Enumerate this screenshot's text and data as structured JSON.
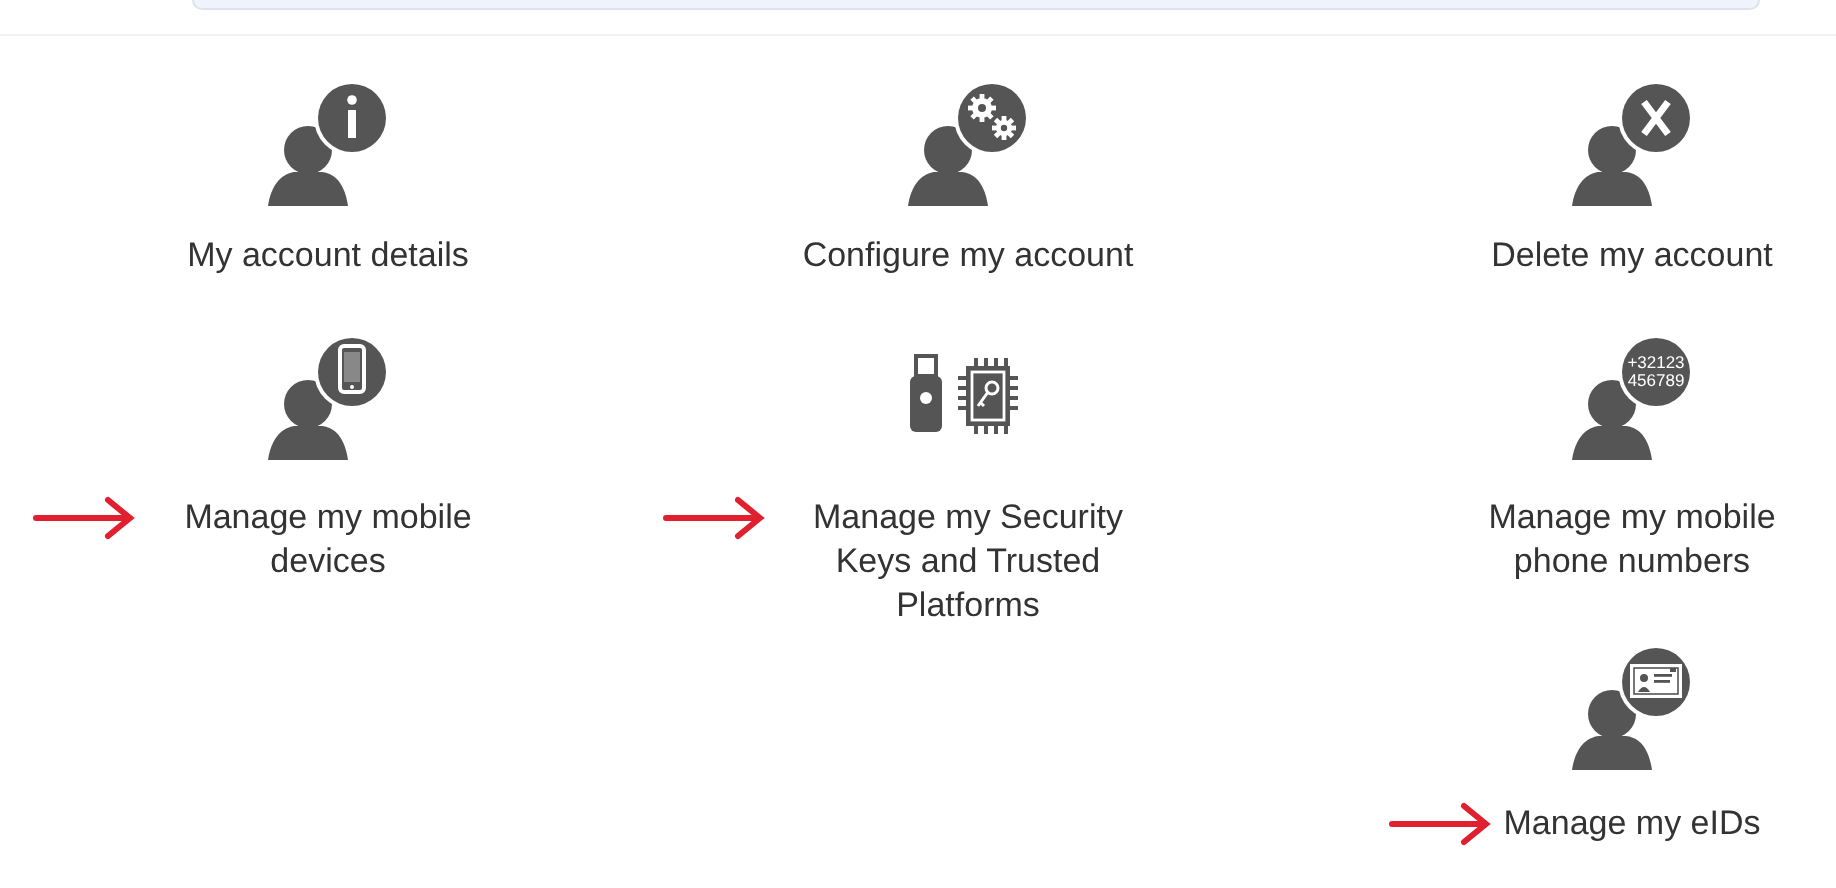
{
  "rows": [
    [
      {
        "kind": "info",
        "label": "My account details",
        "arrow": false
      },
      {
        "kind": "gears",
        "label": "Configure my account",
        "arrow": false
      },
      {
        "kind": "delete",
        "label": "Delete my account",
        "arrow": false
      }
    ],
    [
      {
        "kind": "phone",
        "label": "Manage my mobile devices",
        "arrow": true
      },
      {
        "kind": "keys",
        "label": "Manage my Security Keys and Trusted Platforms",
        "arrow": true
      },
      {
        "kind": "numbers",
        "label": "Manage my mobile phone numbers",
        "arrow": false,
        "badge_lines": [
          "+32123",
          "456789"
        ]
      }
    ],
    [
      null,
      null,
      {
        "kind": "eid",
        "label": "Manage my eIDs",
        "arrow": true
      }
    ]
  ]
}
